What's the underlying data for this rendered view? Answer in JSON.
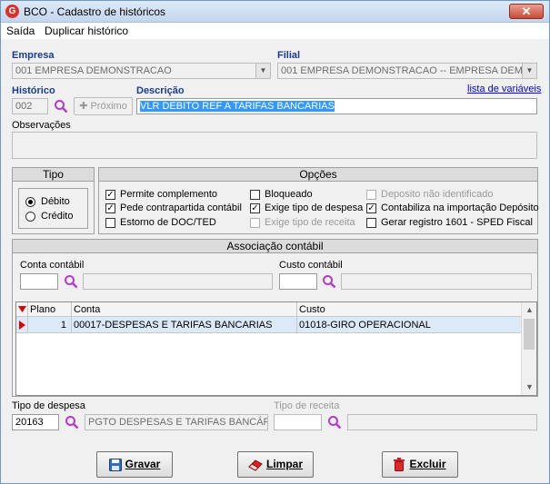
{
  "window": {
    "title": "BCO - Cadastro de históricos",
    "app_icon_letter": "G",
    "close_glyph": "✕"
  },
  "menu": {
    "items": [
      "Saída",
      "Duplicar histórico"
    ]
  },
  "empresa": {
    "label": "Empresa",
    "value": "001 EMPRESA DEMONSTRACAO"
  },
  "filial": {
    "label": "Filial",
    "value": "001 EMPRESA DEMONSTRACAO -- EMPRESA DEMON"
  },
  "historico": {
    "label": "Histórico",
    "value": "002",
    "proximo_label": "Próximo"
  },
  "descricao": {
    "label": "Descrição",
    "value": "VLR DEBITO REF A TARIFAS BANCARIAS",
    "link": "lista de variáveis"
  },
  "observacoes": {
    "label": "Observações",
    "value": ""
  },
  "tipo": {
    "title": "Tipo",
    "options": [
      {
        "label": "Débito",
        "selected": true
      },
      {
        "label": "Crédito",
        "selected": false
      }
    ]
  },
  "opcoes": {
    "title": "Opções",
    "items": [
      {
        "label": "Permite complemento",
        "checked": true,
        "enabled": true
      },
      {
        "label": "Pede contrapartida contábil",
        "checked": true,
        "enabled": true
      },
      {
        "label": "Estorno de DOC/TED",
        "checked": false,
        "enabled": true
      },
      {
        "label": "Bloqueado",
        "checked": false,
        "enabled": true
      },
      {
        "label": "Exige tipo de despesa",
        "checked": true,
        "enabled": true
      },
      {
        "label": "Exige tipo de receita",
        "checked": false,
        "enabled": false
      },
      {
        "label": "Deposito não identificado",
        "checked": false,
        "enabled": false
      },
      {
        "label": "Contabiliza na importação Depósito",
        "checked": true,
        "enabled": true
      },
      {
        "label": "Gerar registro 1601 - SPED Fiscal",
        "checked": false,
        "enabled": true
      }
    ]
  },
  "associacao": {
    "title": "Associação contábil",
    "conta_label": "Conta contábil",
    "conta_value": "",
    "custo_label": "Custo contábil",
    "custo_value": "",
    "grid": {
      "columns": [
        "Plano",
        "Conta",
        "Custo"
      ],
      "rows": [
        {
          "plano": "1",
          "conta": "00017-DESPESAS E TARIFAS BANCARIAS",
          "custo": "01018-GIRO OPERACIONAL"
        }
      ]
    }
  },
  "tipo_despesa": {
    "label": "Tipo de despesa",
    "code": "20163",
    "description": "PGTO DESPESAS E TARIFAS BANCÁRI."
  },
  "tipo_receita": {
    "label": "Tipo de receita",
    "code": "",
    "description": ""
  },
  "buttons": {
    "gravar": "Gravar",
    "limpar": "Limpar",
    "excluir": "Excluir"
  },
  "colors": {
    "label_blue": "#1a3c8c",
    "selection_blue": "#3399ff",
    "row_marker_red": "#e00000"
  }
}
